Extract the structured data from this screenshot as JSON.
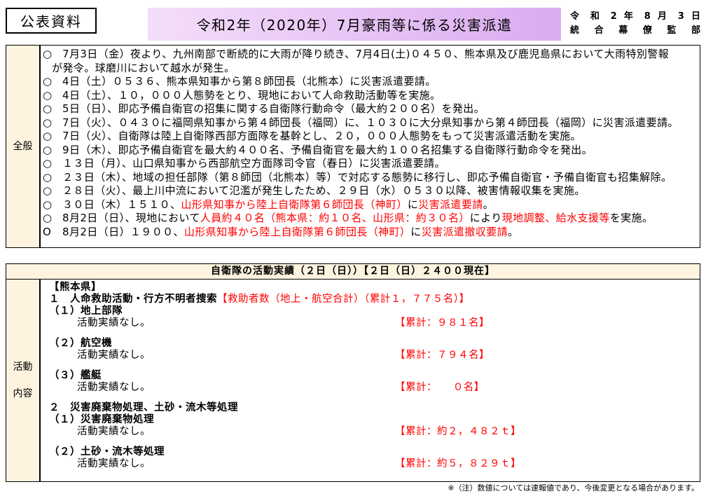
{
  "header": {
    "badge": "公表資料",
    "title": "令和2年（2020年）7月豪雨等に係る災害派遣",
    "date": "令 和 2 年 8 月 3 日",
    "issuer": "統 合 幕 僚 監 部"
  },
  "overview": {
    "label": "全般",
    "items": [
      {
        "bullet": "○",
        "parts": [
          {
            "text": "7月3日（金）夜より、九州南部で断続的に大雨が降り続き、7月4日(土)０４５０、熊本県及び鹿児島県において大雨特別警報",
            "highlight": false
          }
        ],
        "continuation": "が発令。球磨川において越水が発生。"
      },
      {
        "bullet": "○",
        "parts": [
          {
            "text": "4日（土）０５３６、熊本県知事から第８師団長（北熊本）に災害派遣要請。",
            "highlight": false
          }
        ]
      },
      {
        "bullet": "○",
        "parts": [
          {
            "text": "4日（土）、１０，０００人態勢をとり、現地において人命救助活動等を実施。",
            "highlight": false
          }
        ]
      },
      {
        "bullet": "○",
        "parts": [
          {
            "text": "5日（日）、即応予備自衛官の招集に関する自衛隊行動命令（最大約２００名）を発出。",
            "highlight": false
          }
        ]
      },
      {
        "bullet": "○",
        "parts": [
          {
            "text": "7日（火）、０４３０に福岡県知事から第４師団長（福岡）に、１０３０に大分県知事から第４師団長（福岡）に災害派遣要請。",
            "highlight": false
          }
        ]
      },
      {
        "bullet": "○",
        "parts": [
          {
            "text": "7日（火）、自衛隊は陸上自衛隊西部方面隊を基幹とし、２０，０００人態勢をもって災害派遣活動を実施。",
            "highlight": false
          }
        ]
      },
      {
        "bullet": "○",
        "parts": [
          {
            "text": "9日（木）、即応予備自衛官を最大約４００名、予備自衛官を最大約１００名招集する自衛隊行動命令を発出。",
            "highlight": false
          }
        ]
      },
      {
        "bullet": "○",
        "parts": [
          {
            "text": "１３日（月）、山口県知事から西部航空方面隊司令官（春日）に災害派遣要請。",
            "highlight": false
          }
        ]
      },
      {
        "bullet": "○",
        "parts": [
          {
            "text": "２３日（木）、地域の担任部隊（第８師団（北熊本）等）で対応する態勢に移行し、即応予備自衛官・予備自衛官も招集解除。",
            "highlight": false
          }
        ]
      },
      {
        "bullet": "○",
        "parts": [
          {
            "text": "２８日（火）、最上川中流において氾濫が発生したため、２９日（水）０５３０以降、被害情報収集を実施。",
            "highlight": false
          }
        ]
      },
      {
        "bullet": "○",
        "parts": [
          {
            "text": "３０日（木）１５１０、",
            "highlight": false
          },
          {
            "text": "山形県知事から陸上自衛隊第６師団長（神町）",
            "highlight": true
          },
          {
            "text": "に",
            "highlight": false
          },
          {
            "text": "災害派遣要請",
            "highlight": true
          },
          {
            "text": "。",
            "highlight": false
          }
        ]
      },
      {
        "bullet": "○",
        "parts": [
          {
            "text": "8月2日（日）、現地において",
            "highlight": false
          },
          {
            "text": "人員約４０名（熊本県：約１０名、山形県：約３０名）",
            "highlight": true
          },
          {
            "text": "により",
            "highlight": false
          },
          {
            "text": "現地調整、給水支援等",
            "highlight": true
          },
          {
            "text": "を実施。",
            "highlight": false
          }
        ]
      },
      {
        "bullet": "O",
        "parts": [
          {
            "text": "8月2日（日）１９００、",
            "highlight": false
          },
          {
            "text": "山形県知事から陸上自衛隊第６師団長（神町）",
            "highlight": true
          },
          {
            "text": "に",
            "highlight": false
          },
          {
            "text": "災害派遣撤収要請",
            "highlight": true
          },
          {
            "text": "。",
            "highlight": false
          }
        ]
      }
    ]
  },
  "activities": {
    "header": "自衛隊の活動実績（２日（日））【２日（日）２４００現在】",
    "label_top": "活動",
    "label_bottom": "内容",
    "prefecture": "【熊本県】",
    "sections": [
      {
        "heading": "１　人命救助活動・行方不明者捜索",
        "heading_note": "【救助者数（地上・航空合計）（累計１，７７５名）】",
        "subs": [
          {
            "title": "（１）地上部隊",
            "status": "活動実績なし。",
            "total": "【累計：９８１名】"
          },
          {
            "title": "（２）航空機",
            "status": "活動実績なし。",
            "total": "【累計：７９４名】"
          },
          {
            "title": "（３）艦艇",
            "status": "活動実績なし。",
            "total": "【累計：　　０名】"
          }
        ]
      },
      {
        "heading": "２　災害廃棄物処理、土砂・流木等処理",
        "subs": [
          {
            "title": "（１）災害廃棄物処理",
            "status": "活動実績なし。",
            "total": "【累計：約２，４８２ｔ】"
          },
          {
            "title": "（２）土砂・流木等処理",
            "status": "活動実績なし。",
            "total": "【累計：約５，８２９ｔ】"
          }
        ]
      }
    ]
  },
  "footnote": "※（注）数値については速報値であり、今後変更となる場合があります。",
  "colors": {
    "highlight_red": "#ff0000",
    "label_background": "#fdf3df",
    "banner_light": "#f4def9",
    "banner_dark": "#d9abf0"
  }
}
